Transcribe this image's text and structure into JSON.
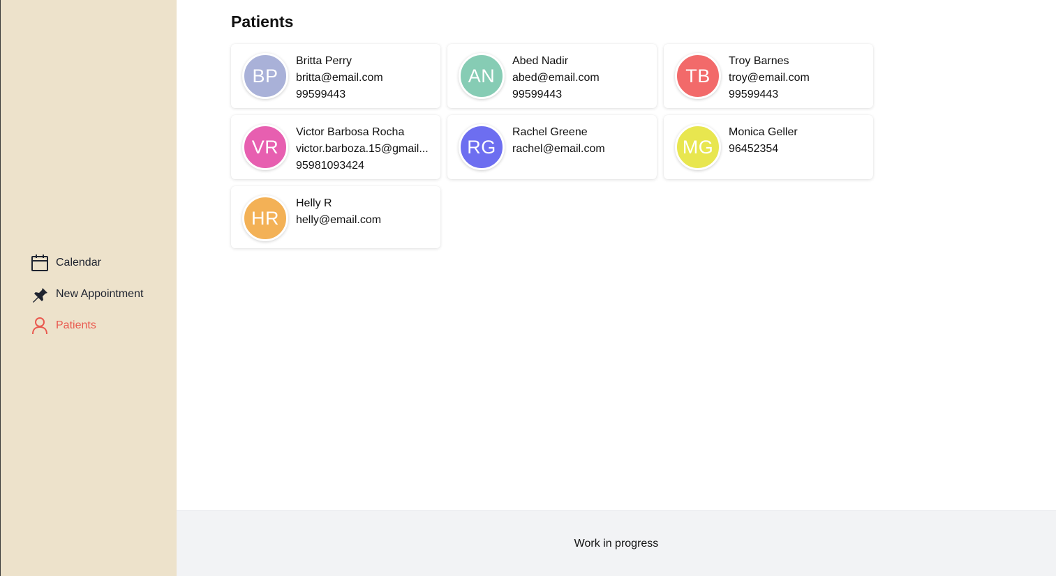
{
  "sidebar": {
    "items": [
      {
        "label": "Calendar",
        "icon": "calendar-icon"
      },
      {
        "label": "New Appointment",
        "icon": "pin-icon"
      },
      {
        "label": "Patients",
        "icon": "user-icon",
        "active": true
      }
    ]
  },
  "page": {
    "title": "Patients"
  },
  "patients": [
    {
      "initials": "BP",
      "name": "Britta Perry",
      "email": "britta@email.com",
      "phone": "99599443",
      "color": "#a9b1d8"
    },
    {
      "initials": "AN",
      "name": "Abed Nadir",
      "email": "abed@email.com",
      "phone": "99599443",
      "color": "#86ccb4"
    },
    {
      "initials": "TB",
      "name": "Troy Barnes",
      "email": "troy@email.com",
      "phone": "99599443",
      "color": "#f26a6a"
    },
    {
      "initials": "VR",
      "name": "Victor Barbosa Rocha",
      "email": "victor.barboza.15@gmail...",
      "phone": "95981093424",
      "color": "#e75fb0"
    },
    {
      "initials": "RG",
      "name": "Rachel Greene",
      "email": "rachel@email.com",
      "phone": "",
      "color": "#6d6ef0"
    },
    {
      "initials": "MG",
      "name": "Monica Geller",
      "email": "",
      "phone": "96452354",
      "color": "#e8e64f"
    },
    {
      "initials": "HR",
      "name": "Helly R",
      "email": "helly@email.com",
      "phone": "",
      "color": "#f3b156"
    }
  ],
  "footer": {
    "text": "Work in progress"
  },
  "colors": {
    "sidebar_bg": "#ede2cb",
    "active_nav": "#e9594f",
    "footer_bg": "#f2f3f5"
  }
}
